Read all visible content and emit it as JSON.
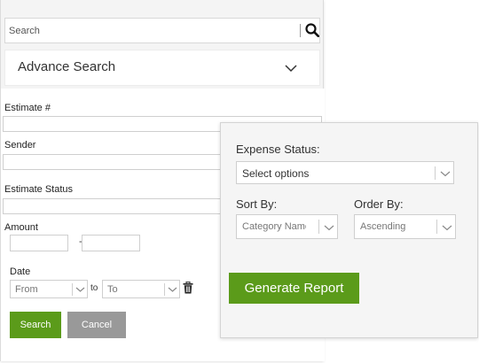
{
  "search": {
    "placeholder": "Search",
    "icon": "search-icon"
  },
  "advance_search": {
    "title": "Advance Search",
    "icon": "chevron-down-icon"
  },
  "filters": {
    "estimate_number_label": "Estimate #",
    "sender_label": "Sender",
    "estimate_status_label": "Estimate Status",
    "amount_label": "Amount",
    "amount_separator": "-",
    "date_label": "Date",
    "date_from": "From",
    "date_to_separator": "to",
    "date_to": "To",
    "clear_icon": "trash-icon"
  },
  "buttons": {
    "search": "Search",
    "cancel": "Cancel",
    "generate_report": "Generate Report"
  },
  "report": {
    "expense_status_label": "Expense Status:",
    "expense_status_value": "Select options",
    "sort_by_label": "Sort By:",
    "sort_by_value": "Category Name",
    "order_by_label": "Order By:",
    "order_by_value": "Ascending"
  },
  "colors": {
    "accent_green": "#5b9b1a",
    "cancel_gray": "#999999"
  }
}
